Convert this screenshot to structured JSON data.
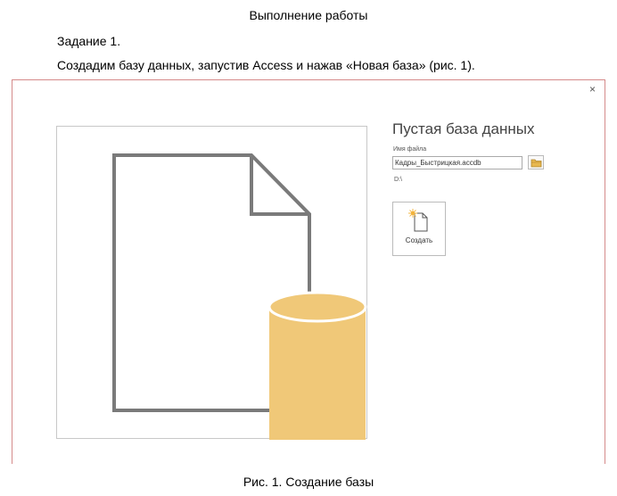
{
  "document": {
    "title": "Выполнение работы",
    "task_heading": "Задание 1.",
    "task_text": "Создадим базу данных, запустив Access и нажав «Новая база» (рис. 1).",
    "caption": "Рис. 1. Создание базы"
  },
  "dialog": {
    "close_glyph": "×",
    "panel_title": "Пустая база данных",
    "file_name_label": "Имя файла",
    "file_name_value": "Кадры_Быстрицкая.accdb",
    "path": "D:\\",
    "browse_icon": "folder-icon",
    "create_button_label": "Создать",
    "create_icon": "new-document-sparkle-icon",
    "preview_icon": "database-document-illustration",
    "colors": {
      "database_fill": "#f0c878",
      "document_stroke": "#7a7a7a",
      "dialog_border": "#d58a8a"
    }
  }
}
